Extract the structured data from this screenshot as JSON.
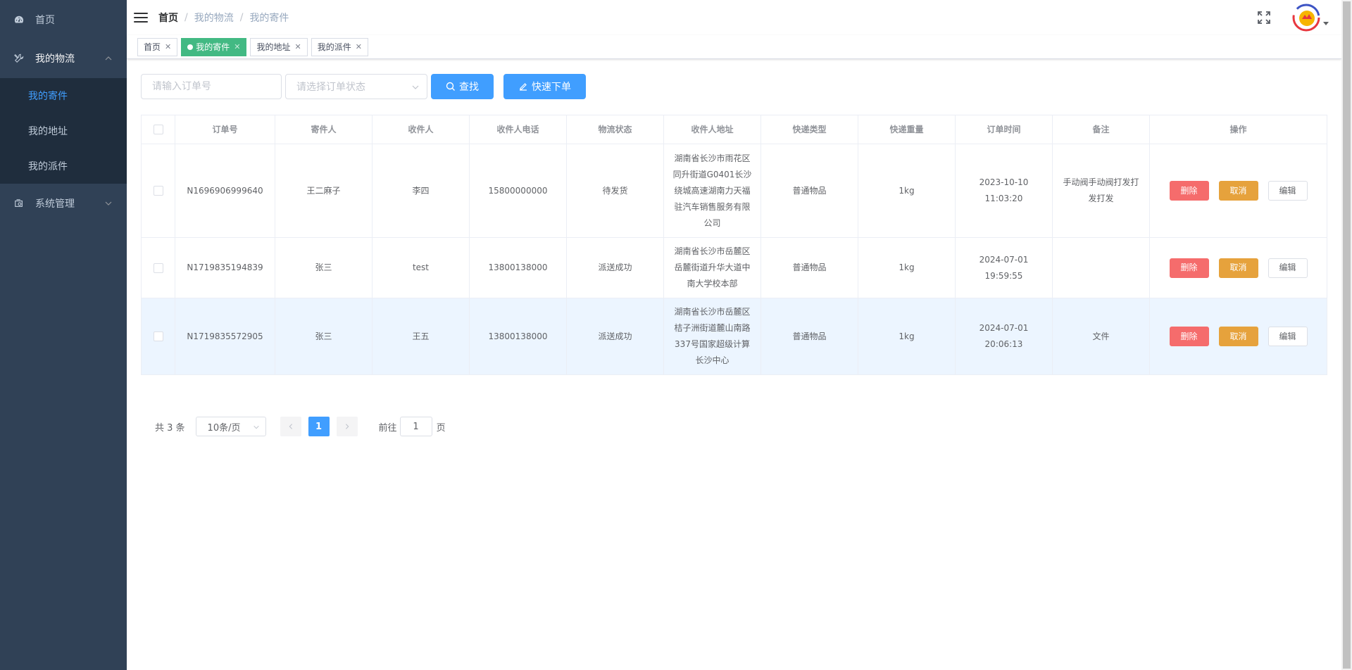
{
  "sidebar": {
    "home": "首页",
    "logistics": "我的物流",
    "sub_items": [
      "我的寄件",
      "我的地址",
      "我的派件"
    ],
    "system": "系统管理"
  },
  "breadcrumb": {
    "first": "首页",
    "second": "我的物流",
    "third": "我的寄件",
    "separator": "/"
  },
  "tags": [
    {
      "label": "首页",
      "active": false
    },
    {
      "label": "我的寄件",
      "active": true
    },
    {
      "label": "我的地址",
      "active": false
    },
    {
      "label": "我的派件",
      "active": false
    }
  ],
  "search": {
    "order_placeholder": "请输入订单号",
    "status_placeholder": "请选择订单状态",
    "search_label": "查找",
    "quick_label": "快速下单"
  },
  "table": {
    "headers": [
      "订单号",
      "寄件人",
      "收件人",
      "收件人电话",
      "物流状态",
      "收件人地址",
      "快递类型",
      "快递重量",
      "订单时间",
      "备注",
      "操作"
    ],
    "rows": [
      [
        "N1696906999640",
        "王二麻子",
        "李四",
        "15800000000",
        "待发货",
        "湖南省长沙市雨花区同升街道G0401长沙绕城高速湖南力天福驻汽车销售服务有限公司",
        "普通物品",
        "1kg",
        "2023-10-10 11:03:20",
        "手动阀手动阀打发打发打发"
      ],
      [
        "N1719835194839",
        "张三",
        "test",
        "13800138000",
        "派送成功",
        "湖南省长沙市岳麓区岳麓街道升华大道中南大学校本部",
        "普通物品",
        "1kg",
        "2024-07-01 19:59:55",
        ""
      ],
      [
        "N1719835572905",
        "张三",
        "王五",
        "13800138000",
        "派送成功",
        "湖南省长沙市岳麓区桔子洲街道麓山南路337号国家超级计算长沙中心",
        "普通物品",
        "1kg",
        "2024-07-01 20:06:13",
        "文件"
      ]
    ],
    "ops": {
      "delete": "删除",
      "cancel": "取消",
      "edit": "编辑"
    }
  },
  "pagination": {
    "total_text": "共 3 条",
    "page_size": "10条/页",
    "current_page": "1",
    "goto_prefix": "前往",
    "goto_value": "1",
    "goto_suffix": "页"
  },
  "colors": {
    "sidebar_bg": "#304156",
    "submenu_bg": "#1f2d3d",
    "primary": "#409eff",
    "active_tag": "#42b983",
    "danger": "#f56c6c",
    "warning": "#e6a23c"
  }
}
